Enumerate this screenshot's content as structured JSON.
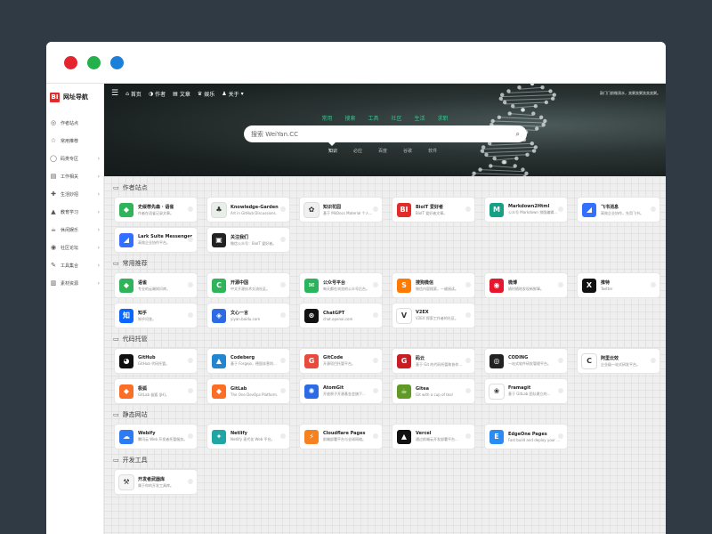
{
  "sidebar": {
    "brand": {
      "logo": "BI",
      "name": "网址导航"
    },
    "items": [
      {
        "label": "作者站点",
        "icon": "◎",
        "chevron": false
      },
      {
        "label": "常用推荐",
        "icon": "☆",
        "chevron": false
      },
      {
        "label": "码类专区",
        "icon": "◯",
        "chevron": true
      },
      {
        "label": "工作相关",
        "icon": "▤",
        "chevron": true
      },
      {
        "label": "生活妙招",
        "icon": "✚",
        "chevron": true
      },
      {
        "label": "教育学习",
        "icon": "▲",
        "chevron": true
      },
      {
        "label": "休闲娱乐",
        "icon": "☕",
        "chevron": true
      },
      {
        "label": "社区论坛",
        "icon": "◉",
        "chevron": true
      },
      {
        "label": "工具集合",
        "icon": "✎",
        "chevron": true
      },
      {
        "label": "素材资源",
        "icon": "▥",
        "chevron": true
      }
    ]
  },
  "topnav": [
    {
      "label": "首页",
      "icon": "⌂"
    },
    {
      "label": "作者",
      "icon": "◑"
    },
    {
      "label": "文章",
      "icon": "▤"
    },
    {
      "label": "娱乐",
      "icon": "♛"
    },
    {
      "label": "关于",
      "icon": "♟"
    }
  ],
  "topright": "敲门门前微淌水，卖粥卖粥卖卖卖粥。",
  "categories": [
    "常用",
    "搜索",
    "工具",
    "社区",
    "生活",
    "求职"
  ],
  "search": {
    "placeholder": "搜索 WeiYan.CC"
  },
  "subtabs": [
    "知识",
    "必应",
    "百度",
    "谷歌",
    "软件"
  ],
  "sections": [
    {
      "title": "作者站点",
      "cards": [
        {
          "name": "史绥荐先森 · 语雀",
          "desc": "作者在语雀记录文章。",
          "color": "#2fb45a",
          "glyph": "◆"
        },
        {
          "name": "Knowledge-Garden",
          "desc": "Art in GitHub Discussions.",
          "color": "#e8efe9",
          "glyph": "♣",
          "dark": true
        },
        {
          "name": "知识花园",
          "desc": "基于 MkDocs Material 个人...",
          "color": "#f0f0f0",
          "glyph": "✿",
          "dark": true
        },
        {
          "name": "BioIT 爱好者",
          "desc": "BioIT 爱好者文章。",
          "color": "#e22c2c",
          "glyph": "BI"
        },
        {
          "name": "Markdown2Html",
          "desc": "公众号 Markdown 排版编辑...",
          "color": "#16a085",
          "glyph": "M"
        },
        {
          "name": "飞书消息",
          "desc": "高效企业协作，先用飞书。",
          "color": "#3370ff",
          "glyph": "◢"
        },
        {
          "name": "Lark Suite Messenger",
          "desc": "高效企业协作平台。",
          "color": "#3370ff",
          "glyph": "◢"
        },
        {
          "name": "关注我们",
          "desc": "微信公众号：BioIT 爱好者。",
          "color": "#222222",
          "glyph": "▣"
        }
      ]
    },
    {
      "title": "常用推荐",
      "cards": [
        {
          "name": "语雀",
          "desc": "专业的云端知识库。",
          "color": "#2fb45a",
          "glyph": "◆"
        },
        {
          "name": "开源中国",
          "desc": "中文开源技术交流社区。",
          "color": "#2fb45a",
          "glyph": "C"
        },
        {
          "name": "公众号平台",
          "desc": "每天都在浏览的公众号后台。",
          "color": "#2ab55d",
          "glyph": "✉"
        },
        {
          "name": "搜狗微信",
          "desc": "微信内容搜索，一键阅读。",
          "color": "#ff7a00",
          "glyph": "S"
        },
        {
          "name": "微博",
          "desc": "随时随地发现新鲜事。",
          "color": "#e6162d",
          "glyph": "◉"
        },
        {
          "name": "推特",
          "desc": "Twitter",
          "color": "#111111",
          "glyph": "X"
        },
        {
          "name": "知乎",
          "desc": "知乎问答。",
          "color": "#0a66ff",
          "glyph": "知"
        },
        {
          "name": "文心一言",
          "desc": "yiyan.baidu.com",
          "color": "#2d6be4",
          "glyph": "◈"
        },
        {
          "name": "ChatGPT",
          "desc": "chat.openai.com",
          "color": "#111111",
          "glyph": "⊛"
        },
        {
          "name": "V2EX",
          "desc": "V2EX 探索工作者的社区。",
          "color": "#ffffff",
          "glyph": "V",
          "dark": true
        }
      ]
    },
    {
      "title": "代码托管",
      "cards": [
        {
          "name": "GitHub",
          "desc": "GitHub 代码托管。",
          "color": "#111111",
          "glyph": "◕"
        },
        {
          "name": "Codeberg",
          "desc": "基于 Forgejo，德国非营利...",
          "color": "#2185d0",
          "glyph": "▲"
        },
        {
          "name": "GitCode",
          "desc": "开源项目托管平台。",
          "color": "#e84a3c",
          "glyph": "G"
        },
        {
          "name": "码云",
          "desc": "基于 Git 的代码托管和协作...",
          "color": "#c71d23",
          "glyph": "G"
        },
        {
          "name": "CODING",
          "desc": "一站式软件研发管理平台。",
          "color": "#222222",
          "glyph": "◎"
        },
        {
          "name": "阿里云效",
          "desc": "企业级一站式研发平台。",
          "color": "#ffffff",
          "glyph": "C",
          "dark": true
        },
        {
          "name": "极狐",
          "desc": "GitLab 极狐 (JH)。",
          "color": "#fc6d26",
          "glyph": "◆"
        },
        {
          "name": "GitLab",
          "desc": "The One DevOps Platform.",
          "color": "#fc6d26",
          "glyph": "◆"
        },
        {
          "name": "AtomGit",
          "desc": "开放原子开源基金会旗下...",
          "color": "#2d6be4",
          "glyph": "✺"
        },
        {
          "name": "Gitea",
          "desc": "Git with a cup of tea!",
          "color": "#609926",
          "glyph": "☕"
        },
        {
          "name": "Framagit",
          "desc": "基于 GitLab 团队建立的...",
          "color": "#ffffff",
          "glyph": "❀",
          "dark": true
        }
      ]
    },
    {
      "title": "静态网站",
      "cards": [
        {
          "name": "Webify",
          "desc": "腾讯云 Web 开发者托管服务。",
          "color": "#2d7bf4",
          "glyph": "☁"
        },
        {
          "name": "Netlify",
          "desc": "Netlify 现代化 Web 平台。",
          "color": "#20a5a5",
          "glyph": "✦"
        },
        {
          "name": "Cloudflare Pages",
          "desc": "前端部署平台与全球网络。",
          "color": "#f6821f",
          "glyph": "⚡"
        },
        {
          "name": "Vercel",
          "desc": "通过前端云开发部署平台...",
          "color": "#111111",
          "glyph": "▲"
        },
        {
          "name": "EdgeOne Pages",
          "desc": "Fast build and deploy your ...",
          "color": "#2a8cf0",
          "glyph": "E"
        }
      ]
    },
    {
      "title": "开发工具",
      "cards": [
        {
          "name": "开发者武器库",
          "desc": "属于你的开发工具库。",
          "color": "#f5f5f5",
          "glyph": "⚒",
          "dark": true
        }
      ]
    }
  ]
}
